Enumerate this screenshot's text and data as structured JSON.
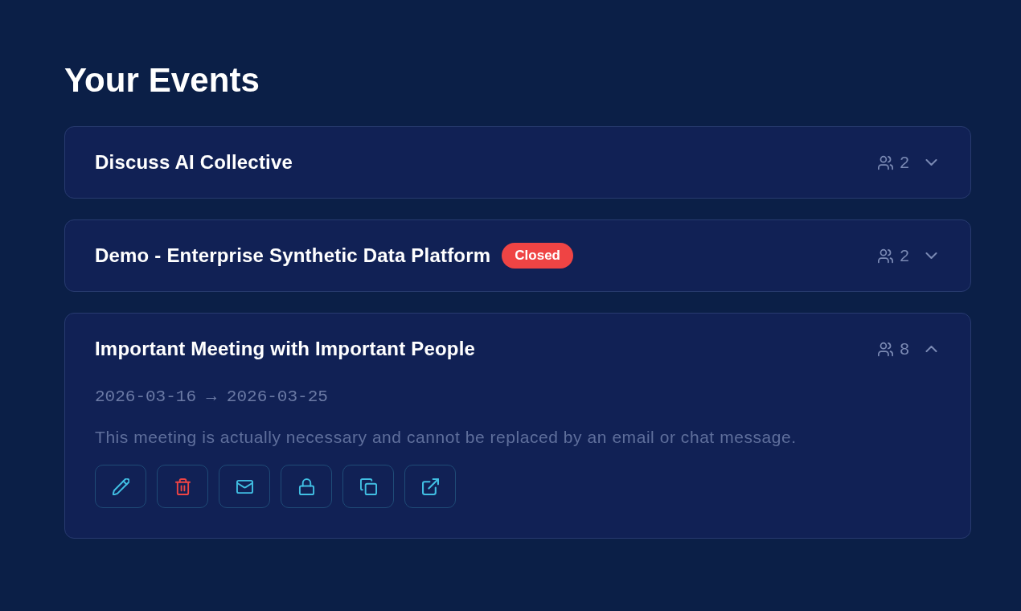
{
  "page": {
    "title": "Your Events"
  },
  "events": [
    {
      "title": "Discuss AI Collective",
      "attendees": "2",
      "expanded": false
    },
    {
      "title": "Demo - Enterprise Synthetic Data Platform",
      "badge": "Closed",
      "attendees": "2",
      "expanded": false
    },
    {
      "title": "Important Meeting with Important People",
      "attendees": "8",
      "expanded": true,
      "dates": "2026-03-16 → 2026-03-25",
      "description": "This meeting is actually necessary and cannot be replaced by an email or chat message.",
      "actions": [
        {
          "kind": "edit"
        },
        {
          "kind": "delete"
        },
        {
          "kind": "email"
        },
        {
          "kind": "lock"
        },
        {
          "kind": "copy"
        },
        {
          "kind": "open"
        }
      ]
    }
  ]
}
